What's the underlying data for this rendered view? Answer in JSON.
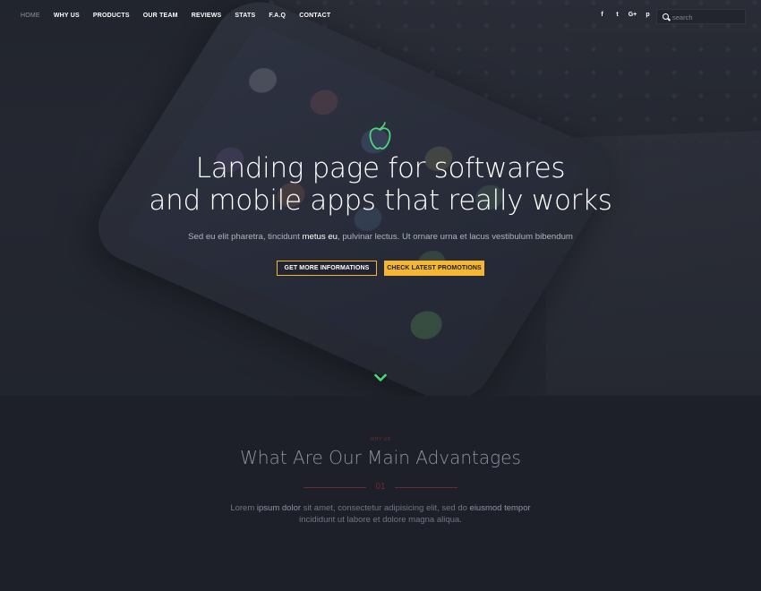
{
  "nav": {
    "items": [
      {
        "label": "HOME",
        "active": true
      },
      {
        "label": "WHY US"
      },
      {
        "label": "PRODUCTS"
      },
      {
        "label": "OUR TEAM"
      },
      {
        "label": "REVIEWS"
      },
      {
        "label": "STATS"
      },
      {
        "label": "F.A.Q"
      },
      {
        "label": "CONTACT"
      }
    ],
    "social": [
      {
        "icon": "facebook-icon",
        "glyph": "f"
      },
      {
        "icon": "twitter-icon",
        "glyph": "t"
      },
      {
        "icon": "google-plus-icon",
        "glyph": "G+"
      },
      {
        "icon": "pinterest-icon",
        "glyph": "p"
      }
    ],
    "search": {
      "placeholder": "search"
    }
  },
  "hero": {
    "icon": "apple-icon",
    "title_line1": "Landing page for softwares",
    "title_line2": "and mobile apps that really works",
    "subtitle_pre": "Sed eu elit pharetra, tincidunt ",
    "subtitle_bold": "metus eu",
    "subtitle_post": ", pulvinar lectus. Ut ornare urna et lacus vestibulum bibendum",
    "button_primary": "GET MORE INFORMATIONS",
    "button_secondary": "CHECK LATEST PROMOTIONS",
    "scroll_icon": "chevron-down-icon"
  },
  "advantages": {
    "eyebrow": "WHY US",
    "title": "What Are Our Main Advantages",
    "number": "01",
    "text_a": "Lorem ",
    "text_b": "ipsum dolor",
    "text_c": " sit amet, consectetur adipisicing elit, sed do ",
    "text_d": "eiusmod tempor",
    "text_e": "incididunt ut labore et dolore magna aliqua."
  },
  "colors": {
    "accent": "#f5b731",
    "green": "#4cd97b",
    "divider": "#6e2a31",
    "background": "#1d2029"
  }
}
